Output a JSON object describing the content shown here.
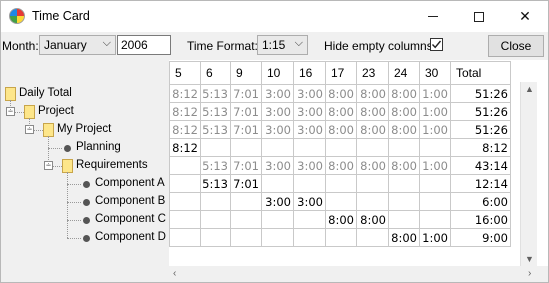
{
  "window": {
    "title": "Time Card",
    "minimize_icon": "minimize-icon",
    "maximize_icon": "maximize-icon",
    "close_glyph": "✕"
  },
  "toolbar": {
    "month_label": "Month:",
    "month_value": "January",
    "year_value": "2006",
    "format_label": "Time Format:",
    "format_value": "1:15",
    "hide_empty_label": "Hide empty columns",
    "hide_empty_checked": true,
    "close_button": "Close"
  },
  "table": {
    "columns": [
      "5",
      "6",
      "9",
      "10",
      "16",
      "17",
      "23",
      "24",
      "30",
      "Total"
    ],
    "rows": [
      {
        "label": "Daily Total",
        "kind": "folder",
        "level": 0,
        "cells": [
          "8:12",
          "5:13",
          "7:01",
          "3:00",
          "3:00",
          "8:00",
          "8:00",
          "8:00",
          "1:00",
          "51:26"
        ],
        "grey": true
      },
      {
        "label": "Project",
        "kind": "folder",
        "level": 1,
        "cells": [
          "8:12",
          "5:13",
          "7:01",
          "3:00",
          "3:00",
          "8:00",
          "8:00",
          "8:00",
          "1:00",
          "51:26"
        ],
        "grey": true
      },
      {
        "label": "My Project",
        "kind": "folder",
        "level": 2,
        "cells": [
          "8:12",
          "5:13",
          "7:01",
          "3:00",
          "3:00",
          "8:00",
          "8:00",
          "8:00",
          "1:00",
          "51:26"
        ],
        "grey": true
      },
      {
        "label": "Planning",
        "kind": "leaf",
        "level": 3,
        "cells": [
          "8:12",
          "",
          "",
          "",
          "",
          "",
          "",
          "",
          "",
          "8:12"
        ],
        "grey": false
      },
      {
        "label": "Requirements",
        "kind": "folder",
        "level": 3,
        "cells": [
          "",
          "5:13",
          "7:01",
          "3:00",
          "3:00",
          "8:00",
          "8:00",
          "8:00",
          "1:00",
          "43:14"
        ],
        "grey": true
      },
      {
        "label": "Component A",
        "kind": "leaf",
        "level": 4,
        "cells": [
          "",
          "5:13",
          "7:01",
          "",
          "",
          "",
          "",
          "",
          "",
          "12:14"
        ],
        "grey": false
      },
      {
        "label": "Component B",
        "kind": "leaf",
        "level": 4,
        "cells": [
          "",
          "",
          "",
          "3:00",
          "3:00",
          "",
          "",
          "",
          "",
          "6:00"
        ],
        "grey": false
      },
      {
        "label": "Component C",
        "kind": "leaf",
        "level": 4,
        "cells": [
          "",
          "",
          "",
          "",
          "",
          "8:00",
          "8:00",
          "",
          "",
          "16:00"
        ],
        "grey": false
      },
      {
        "label": "Component D",
        "kind": "leaf",
        "level": 4,
        "cells": [
          "",
          "",
          "",
          "",
          "",
          "",
          "",
          "8:00",
          "1:00",
          "9:00"
        ],
        "grey": false
      }
    ]
  },
  "scrollbars": {
    "up_arrow": "▲",
    "down_arrow": "▼",
    "left_arrow": "‹",
    "right_arrow": "›"
  }
}
